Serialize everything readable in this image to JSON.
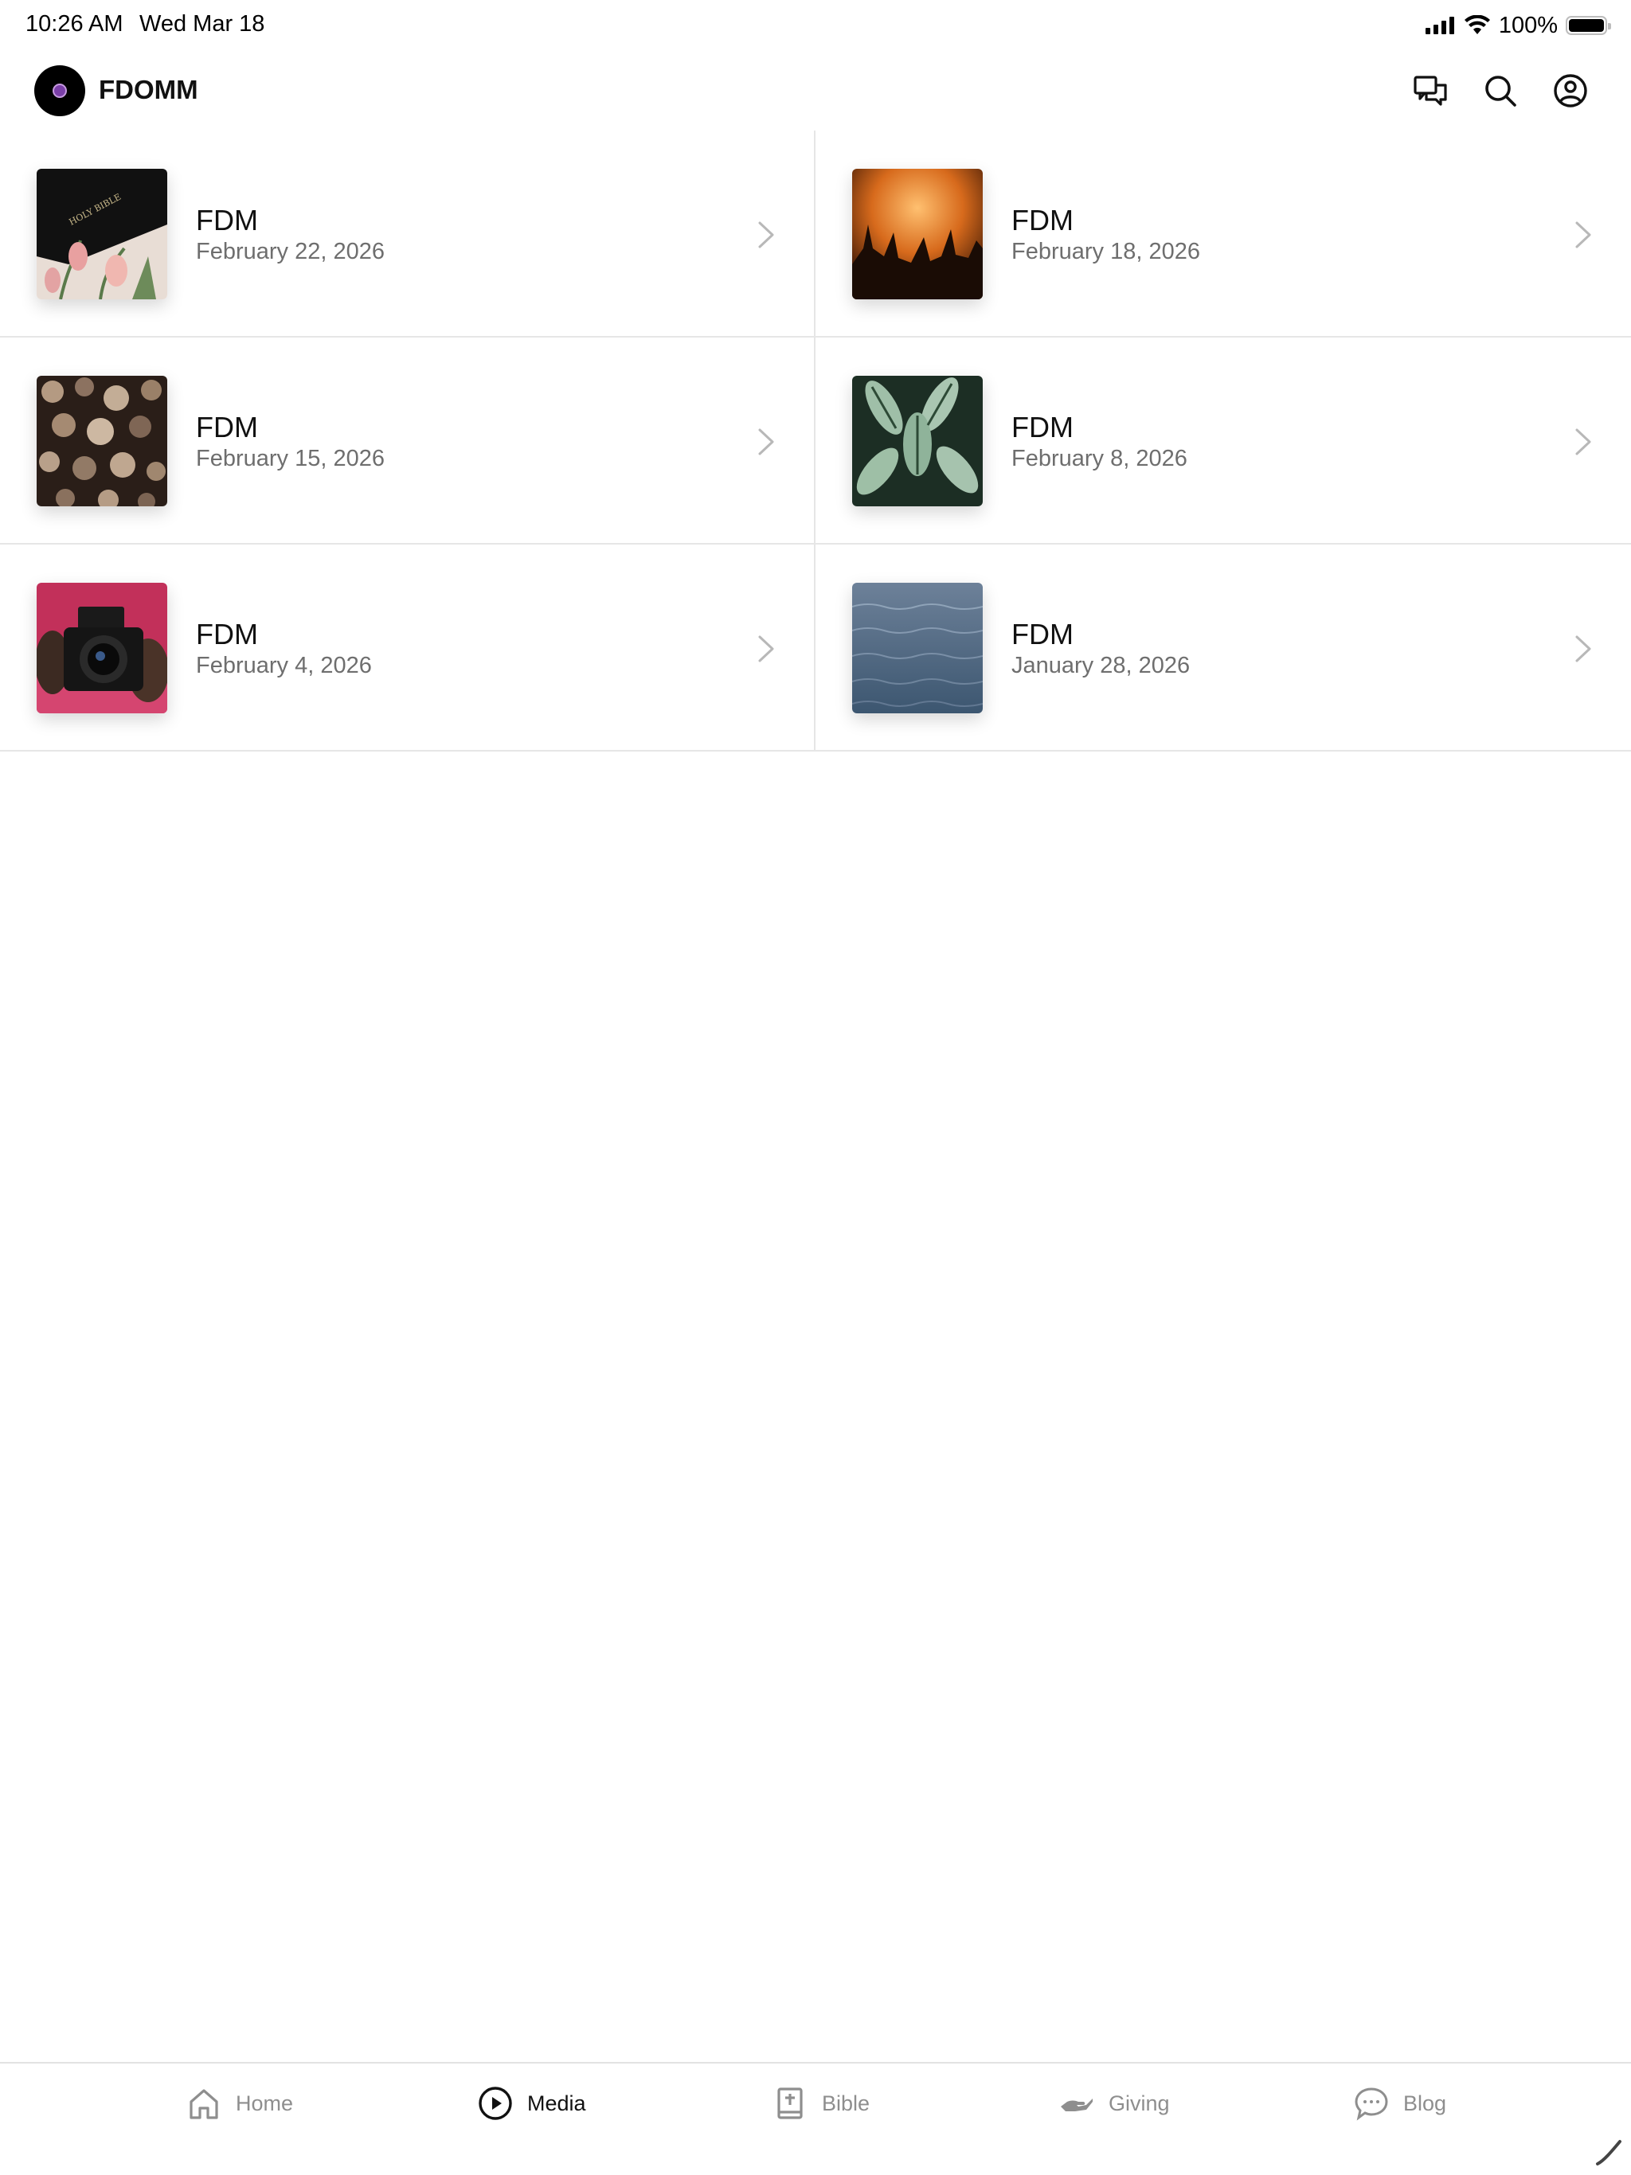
{
  "status_bar": {
    "time": "10:26 AM",
    "date": "Wed Mar 18",
    "battery": "100%"
  },
  "header": {
    "title": "FDOMM",
    "icons": [
      "chat-icon",
      "search-icon",
      "account-icon"
    ]
  },
  "items": [
    {
      "title": "FDM",
      "date": "February 22, 2026",
      "thumbnail": "bible-tulips"
    },
    {
      "title": "FDM",
      "date": "February 18, 2026",
      "thumbnail": "worship-crowd"
    },
    {
      "title": "FDM",
      "date": "February 15, 2026",
      "thumbnail": "wood-logs"
    },
    {
      "title": "FDM",
      "date": "February 8, 2026",
      "thumbnail": "green-leaves"
    },
    {
      "title": "FDM",
      "date": "February 4, 2026",
      "thumbnail": "camera"
    },
    {
      "title": "FDM",
      "date": "January 28, 2026",
      "thumbnail": "ocean-water"
    }
  ],
  "tabs": [
    {
      "label": "Home",
      "icon": "home-icon",
      "active": false
    },
    {
      "label": "Media",
      "icon": "play-circle-icon",
      "active": true
    },
    {
      "label": "Bible",
      "icon": "bible-icon",
      "active": false
    },
    {
      "label": "Giving",
      "icon": "giving-hand-icon",
      "active": false
    },
    {
      "label": "Blog",
      "icon": "chat-bubble-icon",
      "active": false
    }
  ]
}
